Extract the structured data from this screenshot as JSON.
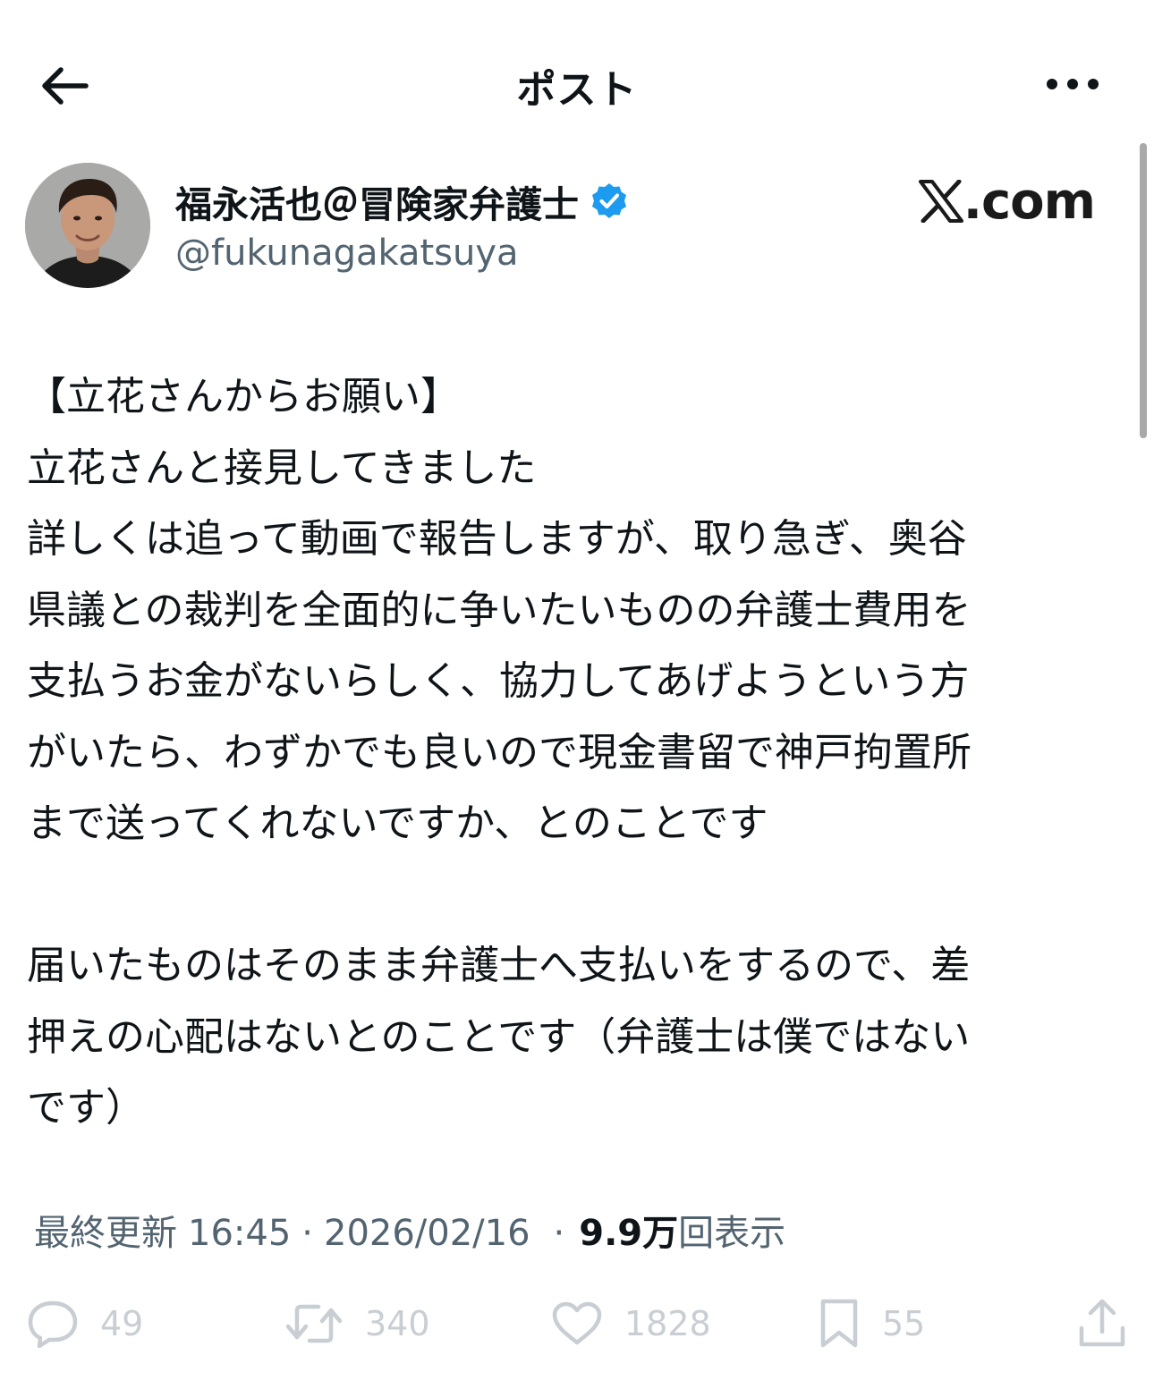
{
  "header": {
    "title": "ポスト"
  },
  "author": {
    "name": "福永活也＠冒険家弁護士",
    "handle": "@fukunagakatsuya",
    "verified": true
  },
  "watermark": {
    "text": ".com"
  },
  "post": {
    "lines": [
      "【立花さんからお願い】",
      "立花さんと接見してきました",
      "詳しくは追って動画で報告しますが、取り急ぎ、奥谷",
      "県議との裁判を全面的に争いたいものの弁護士費用を",
      "支払うお金がないらしく、協力してあげようという方",
      "がいたら、わずかでも良いので現金書留で神戸拘置所",
      "まで送ってくれないですか、とのことです",
      "",
      "届いたものはそのまま弁護士へ支払いをするので、差",
      "押えの心配はないとのことです（弁護士は僕ではない",
      "です）"
    ]
  },
  "meta": {
    "label": "最終更新",
    "time": "16:45",
    "separator": "·",
    "date": "2026/02/16",
    "views_count": "9.9万",
    "views_label": "回表示"
  },
  "actions": {
    "replies": "49",
    "reposts": "340",
    "likes": "1828",
    "bookmarks": "55"
  },
  "colors": {
    "text": "#0f1419",
    "secondary": "#536471",
    "action_icon": "#c8ced3",
    "verified_badge": "#1d9bf0"
  },
  "icons": {
    "back": "arrow-left-icon",
    "more": "more-horizontal-icon",
    "verified": "verified-badge-icon",
    "reply": "speech-bubble-icon",
    "repost": "repost-arrows-icon",
    "like": "heart-icon",
    "bookmark": "bookmark-icon",
    "share": "share-upload-icon"
  }
}
